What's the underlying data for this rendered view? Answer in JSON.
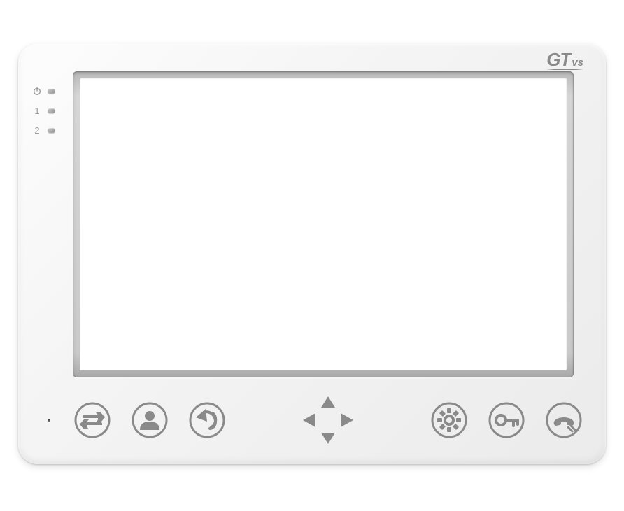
{
  "brand": {
    "primary": "GT",
    "secondary": "vs"
  },
  "leds": [
    {
      "label_kind": "power-icon",
      "label_text": ""
    },
    {
      "label_kind": "text",
      "label_text": "1"
    },
    {
      "label_kind": "text",
      "label_text": "2"
    }
  ],
  "buttons": {
    "left": [
      "transfer",
      "monitor",
      "back"
    ],
    "right": [
      "settings",
      "unlock",
      "talk"
    ]
  },
  "colors": {
    "body": "#f2f2f2",
    "glyph": "#8a8a8a"
  }
}
